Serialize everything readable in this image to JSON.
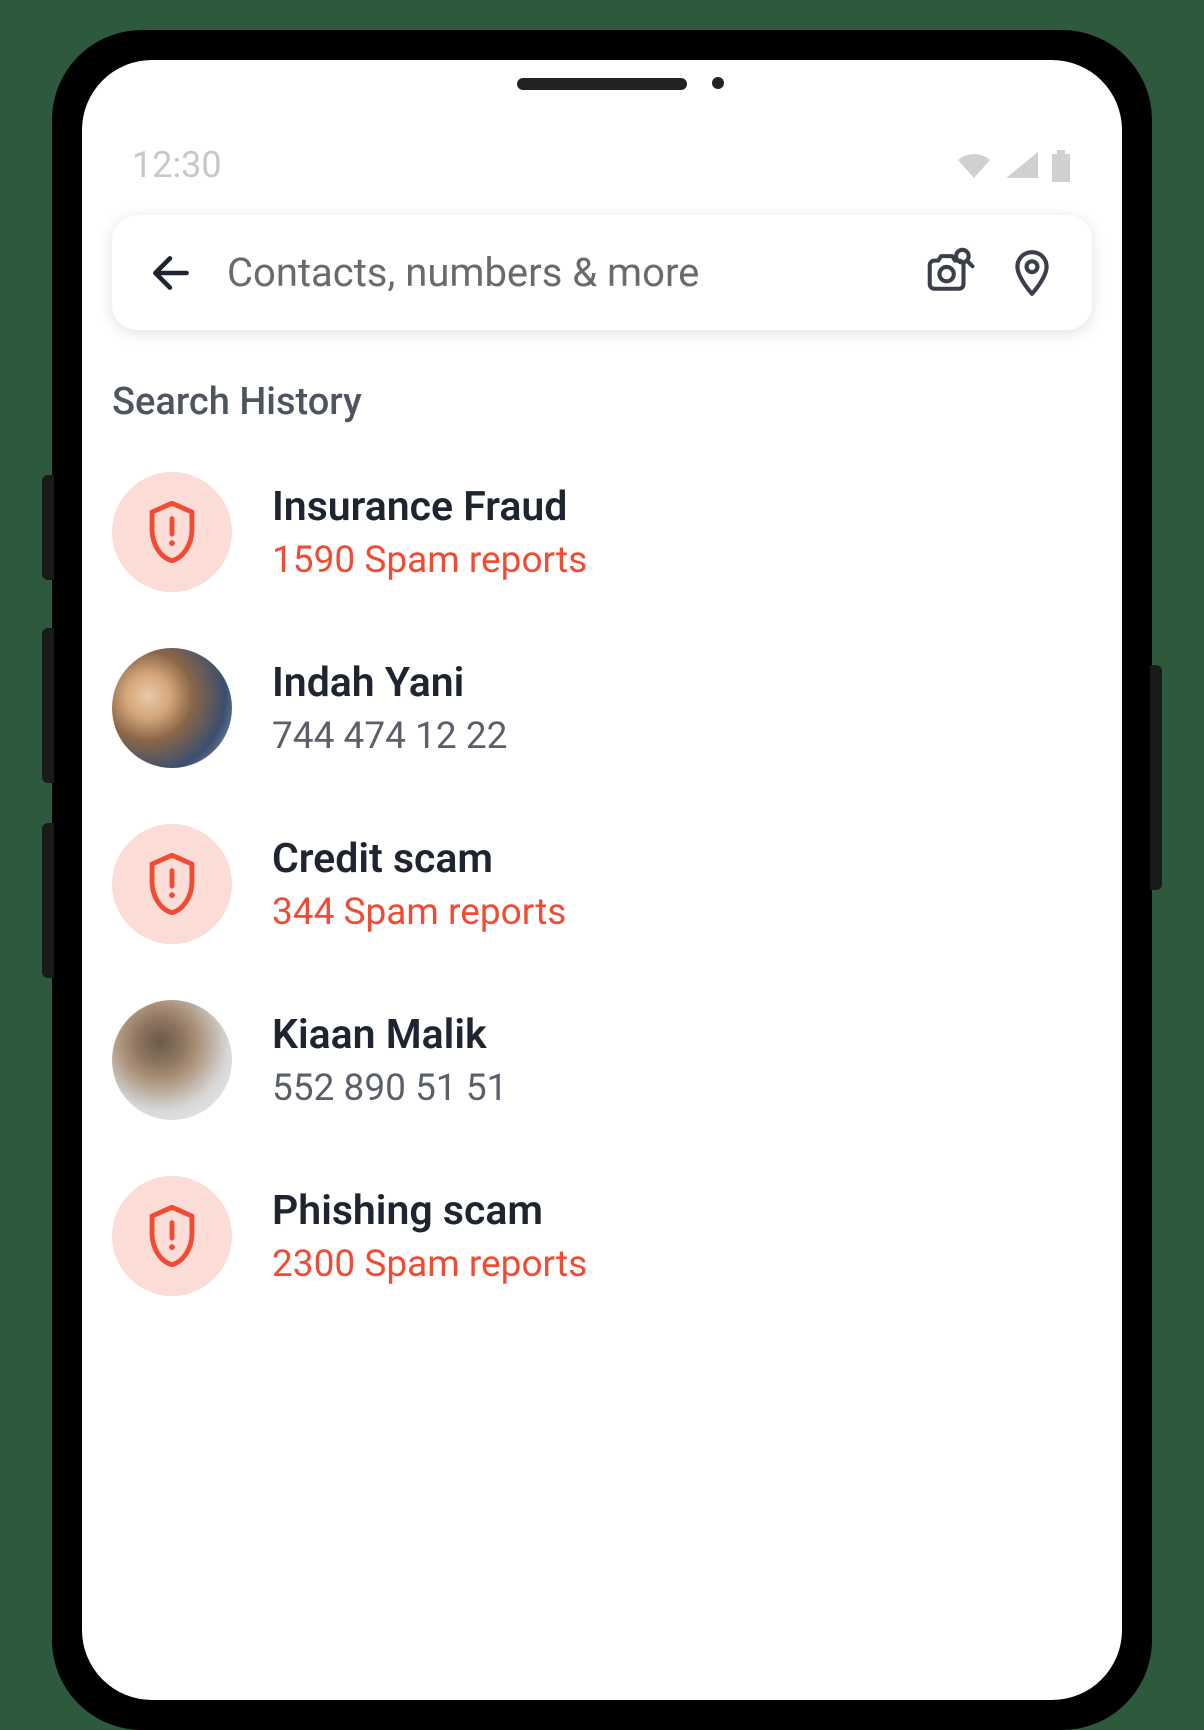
{
  "status": {
    "time": "12:30"
  },
  "search": {
    "placeholder": "Contacts, numbers & more"
  },
  "section": {
    "title": "Search History"
  },
  "items": [
    {
      "type": "spam",
      "title": "Insurance Fraud",
      "subtitle": "1590 Spam reports"
    },
    {
      "type": "contact",
      "title": "Indah Yani",
      "subtitle": "744 474 12 22"
    },
    {
      "type": "spam",
      "title": "Credit scam",
      "subtitle": "344 Spam reports"
    },
    {
      "type": "contact",
      "title": "Kiaan Malik",
      "subtitle": "552 890 51 51"
    },
    {
      "type": "spam",
      "title": "Phishing scam",
      "subtitle": "2300 Spam reports"
    }
  ]
}
